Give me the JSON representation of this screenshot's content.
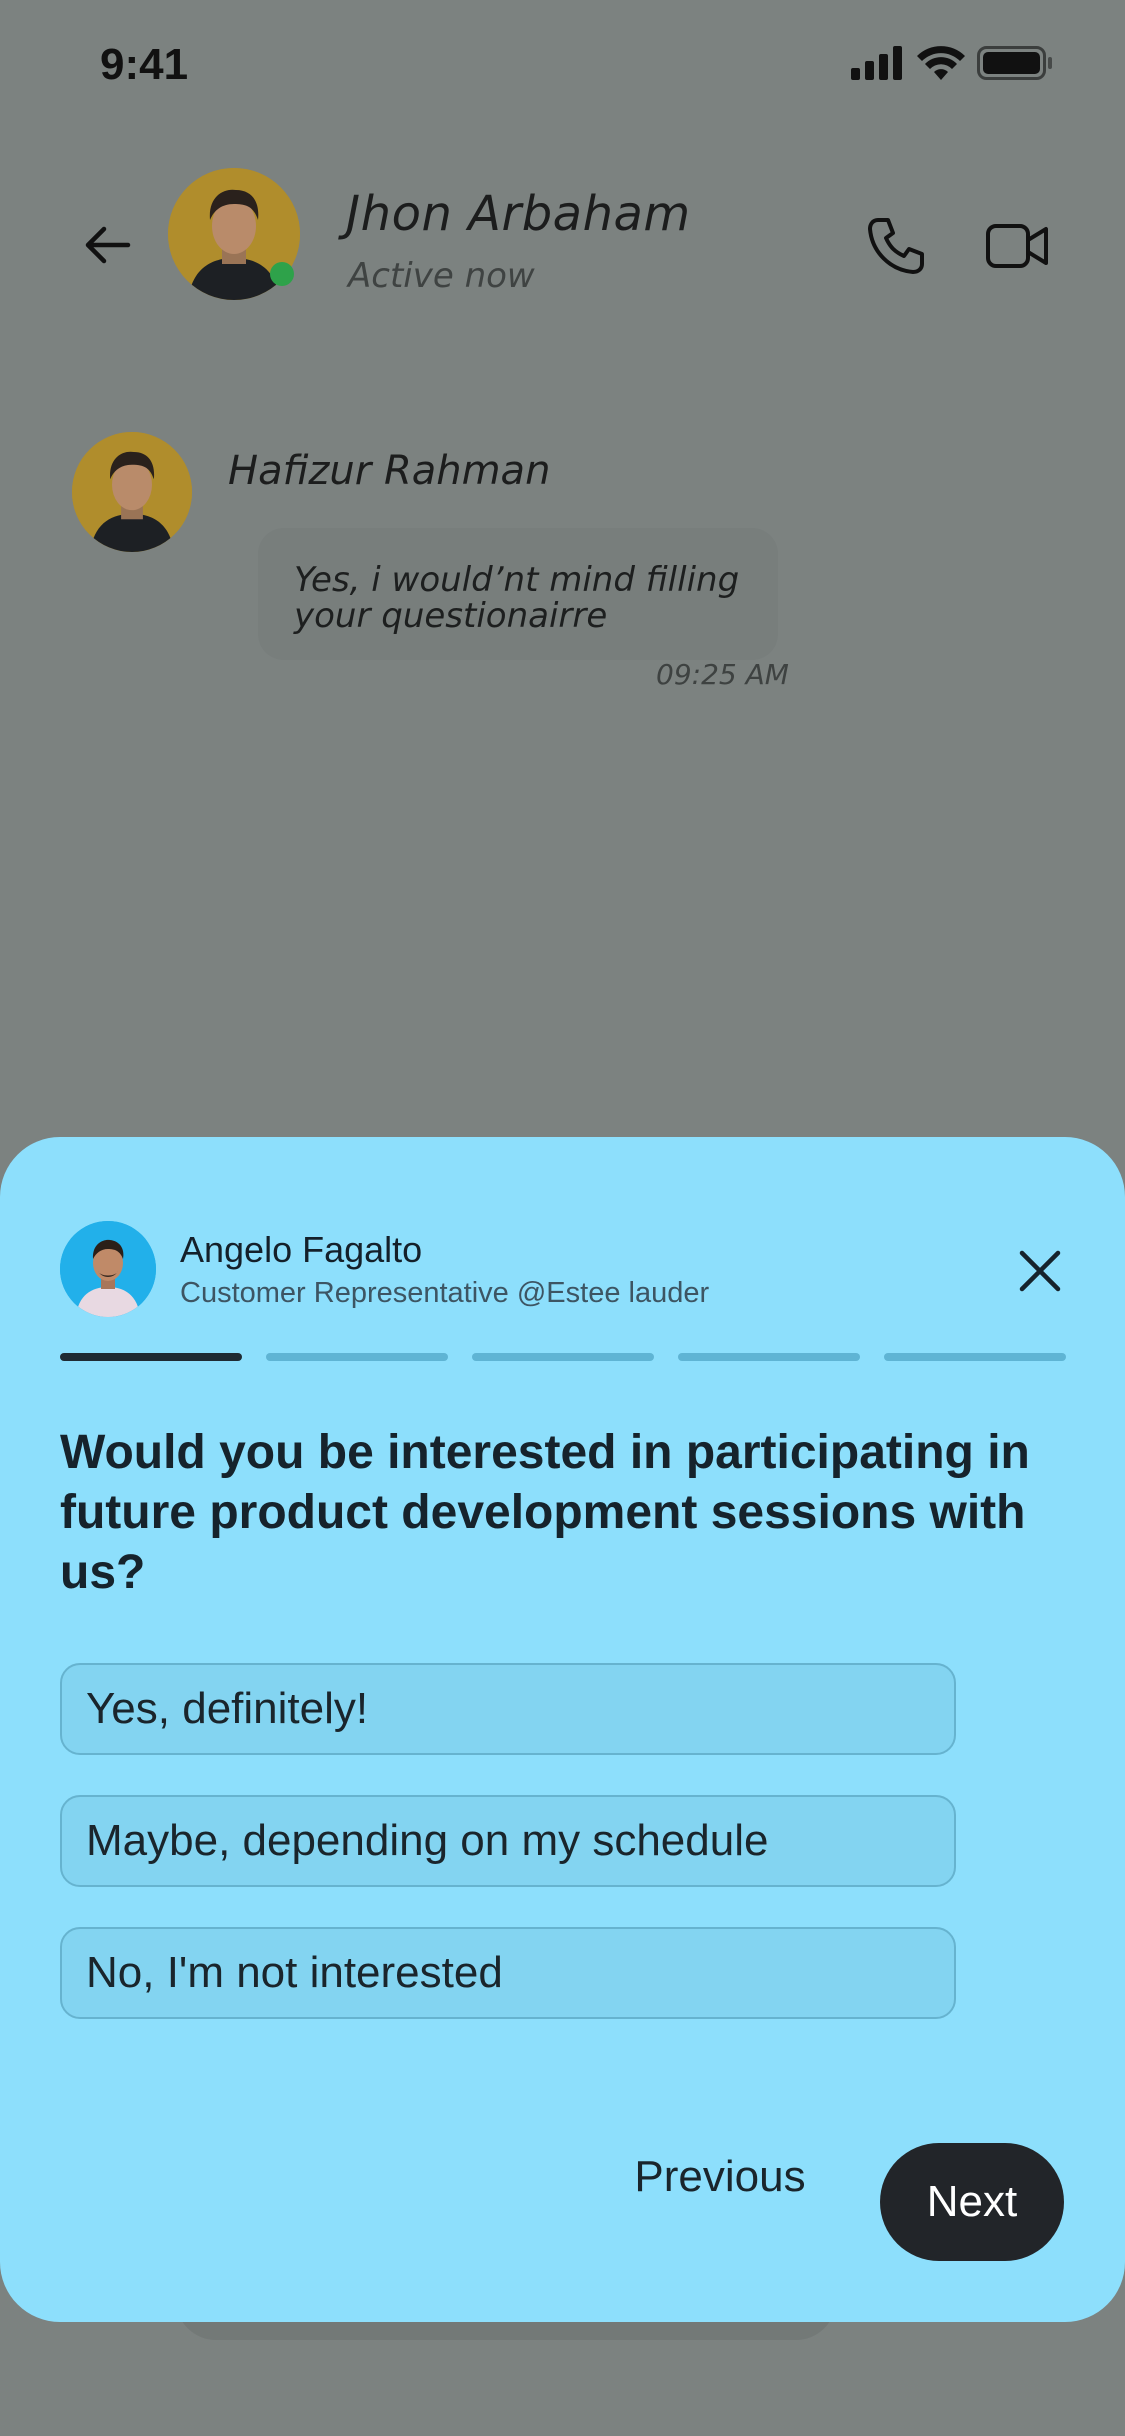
{
  "status_bar": {
    "time": "9:41",
    "icons": [
      "cellular-signal-icon",
      "wifi-icon",
      "battery-icon"
    ]
  },
  "chat_header": {
    "contact_name": "Jhon Arbaham",
    "contact_status": "Active now",
    "icons": [
      "back-arrow-icon",
      "phone-icon",
      "video-camera-icon"
    ],
    "online_color": "#2ea24a"
  },
  "message": {
    "sender": "Hafizur Rahman",
    "text": "Yes, i would’nt mind filling your questionairre",
    "time": "09:25 AM"
  },
  "survey": {
    "representative": {
      "name": "Angelo Fagalto",
      "title": "Customer Representative @Estee lauder"
    },
    "progress": {
      "current_step": 1,
      "total_steps": 5
    },
    "question": "Would you be interested in participating in future product development sessions with us?",
    "options": [
      "Yes, definitely!",
      "Maybe, depending on my schedule",
      "No, I'm not interested"
    ],
    "previous_label": "Previous",
    "next_label": "Next",
    "colors": {
      "sheet_background": "#8ddffc",
      "primary_button": "#222529"
    }
  }
}
